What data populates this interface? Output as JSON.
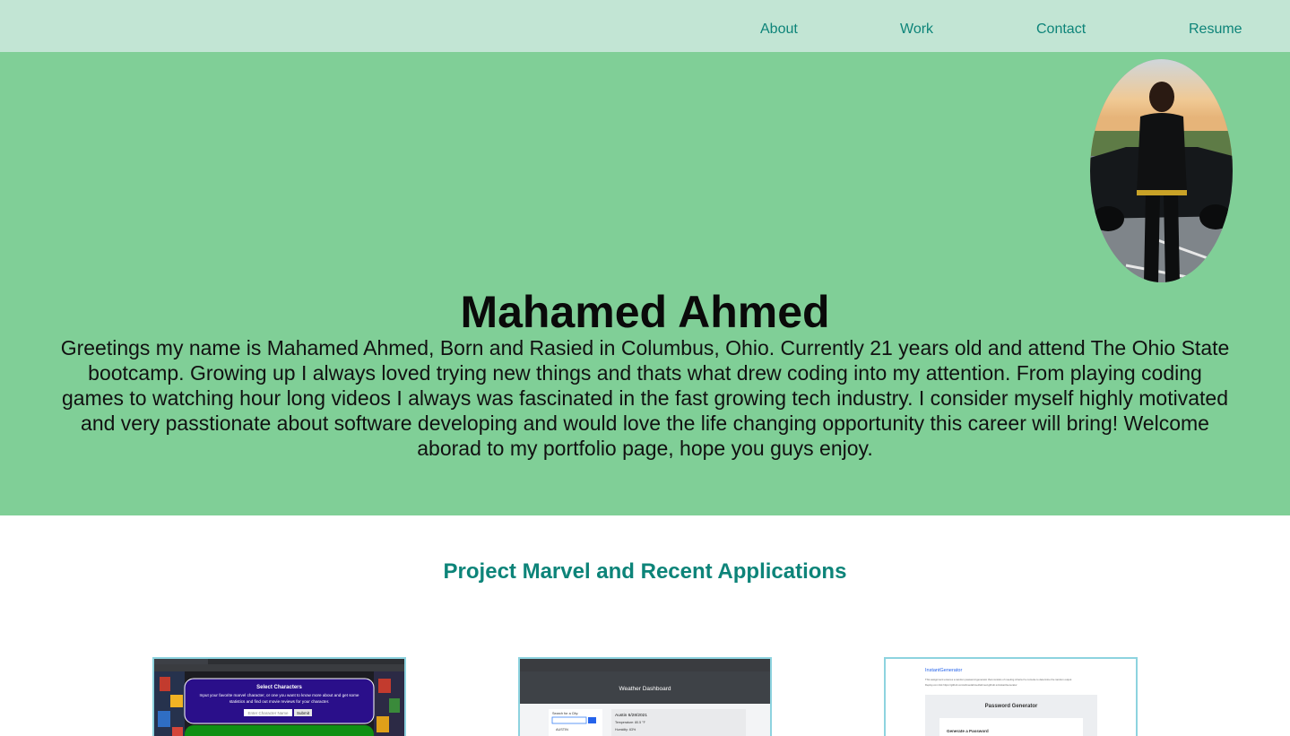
{
  "nav": {
    "about": "About",
    "work": "Work",
    "contact": "Contact",
    "resume": "Resume"
  },
  "hero": {
    "name": "Mahamed Ahmed",
    "bio": "Greetings my name is Mahamed Ahmed, Born and Rasied in Columbus, Ohio. Currently 21 years old and attend The Ohio State bootcamp. Growing up I always loved trying new things and thats what drew coding into my attention. From playing coding games to watching hour long videos I always was fascinated in the fast growing tech industry. I consider myself highly motivated and very passtionate about software developing and would love the life changing opportunity this career will bring! Welcome aborad to my portfolio page, hope you guys enjoy."
  },
  "projects": {
    "title": "Project Marvel and Recent Applications",
    "cards": [
      {
        "heading": "Select Characters",
        "text_line1": "Input your favorite marvel character, or one you want to know more about and get some",
        "text_line2": "statistics and find out movie reviews for your character.",
        "input_placeholder": "Enter Character Name",
        "button": "Submit"
      },
      {
        "heading": "Weather Dashboard",
        "search_label": "Search for a City:",
        "city_item": "AUSTIN",
        "result_title": "Austin 6/28/2021",
        "result_line1": "Temperature: 80.5 °F",
        "result_line2": "Humidity: 63%"
      },
      {
        "heading": "InstantGenerator",
        "desc_line1": "This assignment ensures a random password generator that consists of meeting criteria if a console to determine the random output",
        "desc_line2": "Deploy.com link https://github.com/ahmedahmed/ahmed.github.io/instantGenerator",
        "box_title": "Password Generator",
        "inner_title": "Generate a Password"
      }
    ]
  }
}
